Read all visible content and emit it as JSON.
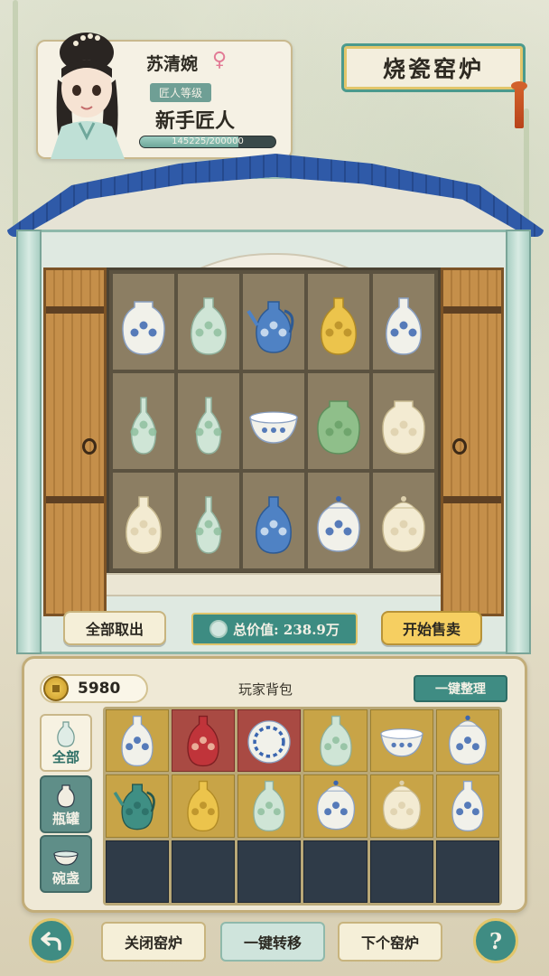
{
  "player": {
    "name": "苏清婉",
    "gender_icon": "female-symbol",
    "rank_tag": "匠人等级",
    "rank": "新手匠人",
    "exp_text": "145225/200000",
    "exp_current": 145225,
    "exp_max": 200000
  },
  "kiln": {
    "title": "烧瓷窑炉",
    "shelf_items": [
      [
        "blue-white-jar",
        "celadon-vase",
        "blue-ewer",
        "yellow-vase",
        "blue-white-vase"
      ],
      [
        "celadon-tall-vase",
        "celadon-small-vase",
        "blue-white-bowl",
        "green-jar",
        "cream-jar"
      ],
      [
        "cream-vase",
        "celadon-small-vase",
        "blue-vase",
        "blue-white-lidded-jar",
        "cream-lidded-jar"
      ]
    ],
    "extra_items": [
      "blue-white-jar-right",
      "yellow-jar"
    ],
    "buttons": {
      "take_all": "全部取出",
      "total_value": "总价值: 238.9万",
      "start_sell": "开始售卖"
    }
  },
  "bag": {
    "gold": "5980",
    "title": "玩家背包",
    "sort_label": "一键整理",
    "categories": [
      {
        "label": "全部",
        "icon": "vase-icon",
        "active": true
      },
      {
        "label": "瓶罐",
        "icon": "jar-icon",
        "active": false
      },
      {
        "label": "碗盏",
        "icon": "bowl-icon",
        "active": false
      }
    ],
    "slots": [
      {
        "item": "blue-white-vase",
        "bg": "gold"
      },
      {
        "item": "red-vase",
        "bg": "red"
      },
      {
        "item": "blue-white-plate",
        "bg": "red"
      },
      {
        "item": "celadon-vase",
        "bg": "gold"
      },
      {
        "item": "blue-white-bowl",
        "bg": "gold"
      },
      {
        "item": "blue-white-lidded-jar",
        "bg": "gold"
      },
      {
        "item": "teal-ewer",
        "bg": "gold"
      },
      {
        "item": "yellow-vase",
        "bg": "gold"
      },
      {
        "item": "celadon-vase",
        "bg": "gold"
      },
      {
        "item": "blue-white-lidded-jar",
        "bg": "gold"
      },
      {
        "item": "cream-lidded-jar",
        "bg": "gold"
      },
      {
        "item": "blue-white-vase",
        "bg": "gold"
      },
      {
        "item": null,
        "bg": "empty"
      },
      {
        "item": null,
        "bg": "empty"
      },
      {
        "item": null,
        "bg": "empty"
      },
      {
        "item": null,
        "bg": "empty"
      },
      {
        "item": null,
        "bg": "empty"
      },
      {
        "item": null,
        "bg": "empty"
      }
    ]
  },
  "bottom": {
    "back_icon": "back-arrow-icon",
    "close_kiln": "关闭窑炉",
    "transfer_all": "一键转移",
    "next_kiln": "下个窑炉",
    "help_label": "?"
  },
  "colors": {
    "teal": "#3f8c83",
    "gold": "#f6cf61",
    "porcelain_blue": "#2f5aa8",
    "slot_gold": "#c8a447",
    "slot_red": "#a94a43"
  }
}
